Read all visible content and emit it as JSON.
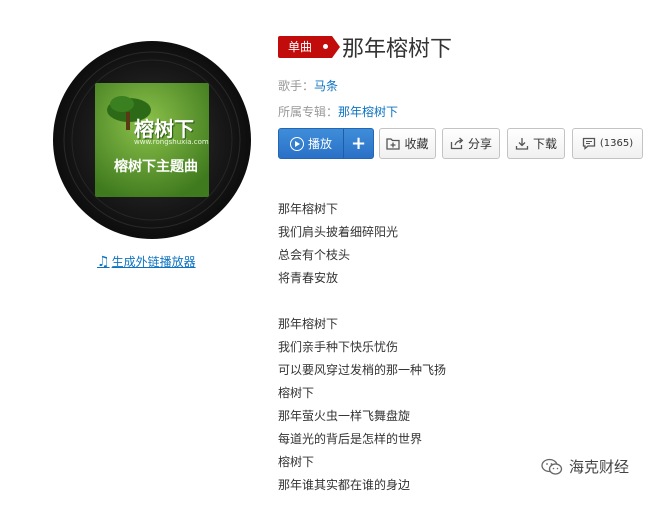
{
  "cover": {
    "logo_text": "榕树下",
    "url_text": "www.rongshuxia.com",
    "subtitle": "榕树下主题曲",
    "colors": {
      "vinyl": "#1a1a1a",
      "label_green": "#5c9b2c"
    }
  },
  "external_player_link": "生成外链播放器",
  "song": {
    "badge": "单曲",
    "title": "那年榕树下",
    "singer_label": "歌手：",
    "singer": "马条",
    "album_label": "所属专辑：",
    "album": "那年榕树下"
  },
  "toolbar": {
    "play_label": "播放",
    "add_label": "+",
    "favorite_label": "收藏",
    "share_label": "分享",
    "download_label": "下载",
    "comment_count": "(1365)"
  },
  "lyrics": {
    "stanza1": [
      "那年榕树下",
      "我们肩头披着细碎阳光",
      "总会有个枝头",
      "将青春安放"
    ],
    "stanza2": [
      "那年榕树下",
      "我们亲手种下快乐忧伤",
      "可以要风穿过发梢的那一种飞扬",
      "榕树下",
      "那年萤火虫一样飞舞盘旋",
      "每道光的背后是怎样的世界",
      "榕树下",
      "那年谁其实都在谁的身边"
    ]
  },
  "watermark": "海克财经",
  "colors": {
    "accent_blue": "#0c73c2",
    "badge_red": "#c20c0c",
    "play_blue": "#2a71c7"
  }
}
